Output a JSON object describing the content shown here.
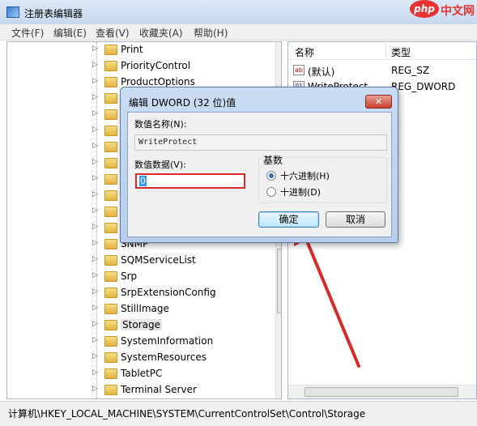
{
  "window": {
    "title": "注册表编辑器"
  },
  "watermark": {
    "logo": "php",
    "site": "中文网"
  },
  "menu": [
    "文件(F)",
    "编辑(E)",
    "查看(V)",
    "收藏夹(A)",
    "帮助(H)"
  ],
  "tree": {
    "items": [
      {
        "label": "Print"
      },
      {
        "label": "PriorityControl"
      },
      {
        "label": "ProductOptions"
      },
      {
        "label": ""
      },
      {
        "label": ""
      },
      {
        "label": ""
      },
      {
        "label": ""
      },
      {
        "label": ""
      },
      {
        "label": ""
      },
      {
        "label": ""
      },
      {
        "label": ""
      },
      {
        "label": ""
      },
      {
        "label": "SNMP"
      },
      {
        "label": "SQMServiceList"
      },
      {
        "label": "Srp"
      },
      {
        "label": "SrpExtensionConfig"
      },
      {
        "label": "StillImage"
      },
      {
        "label": "Storage"
      },
      {
        "label": "SystemInformation"
      },
      {
        "label": "SystemResources"
      },
      {
        "label": "TabletPC"
      },
      {
        "label": "Terminal Server"
      }
    ]
  },
  "list": {
    "headers": {
      "name": "名称",
      "type": "类型"
    },
    "rows": [
      {
        "name": "(默认)",
        "type": "REG_SZ",
        "icon": "ab-string-icon"
      },
      {
        "name": "WriteProtect",
        "type": "REG_DWORD",
        "icon": "binary-value-icon"
      }
    ]
  },
  "status": {
    "path": "计算机\\HKEY_LOCAL_MACHINE\\SYSTEM\\CurrentControlSet\\Control\\Storage"
  },
  "dialog": {
    "title": "编辑 DWORD (32 位)值",
    "close_label": "✕",
    "value_name_label": "数值名称(N):",
    "value_name": "WriteProtect",
    "value_data_label": "数值数据(V):",
    "value_data": "0",
    "base_label": "基数",
    "radix_options": [
      {
        "label": "十六进制(H)",
        "selected": true
      },
      {
        "label": "十进制(D)",
        "selected": false
      }
    ],
    "ok_label": "确定",
    "cancel_label": "取消"
  },
  "colors": {
    "annotation_red": "#d82a2a",
    "selection_blue": "#3399ff"
  }
}
